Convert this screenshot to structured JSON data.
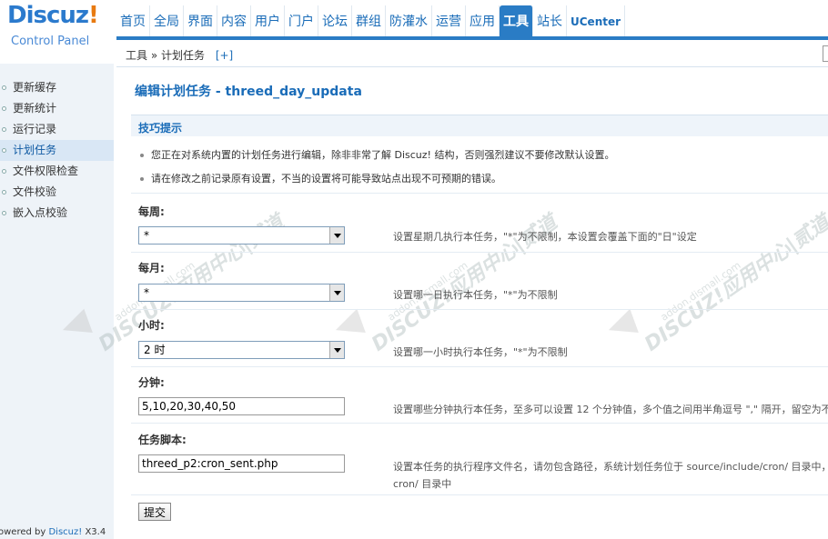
{
  "logo": {
    "brand": "Discuz",
    "exclaim": "!",
    "subtitle": "Control Panel"
  },
  "nav": {
    "tabs": [
      "首页",
      "全局",
      "界面",
      "内容",
      "用户",
      "门户",
      "论坛",
      "群组",
      "防灌水",
      "运营",
      "应用",
      "工具",
      "站长",
      "UCenter"
    ],
    "active": "工具"
  },
  "breadcrumb": {
    "path": "工具 » 计划任务",
    "plus": "[+]"
  },
  "sidebar": {
    "items": [
      "更新缓存",
      "更新统计",
      "运行记录",
      "计划任务",
      "文件权限检查",
      "文件校验",
      "嵌入点校验"
    ],
    "active": "计划任务",
    "powered_prefix": "owered by ",
    "powered_link": "Discuz!",
    "powered_version": " X3.4"
  },
  "main": {
    "title": "编辑计划任务 - threed_day_updata",
    "tips_title": "技巧提示",
    "tips": [
      "您正在对系统内置的计划任务进行编辑，除非非常了解 Discuz! 结构，否则强烈建议不要修改默认设置。",
      "请在修改之前记录原有设置，不当的设置将可能导致站点出现不可预期的错误。"
    ],
    "fields": {
      "week": {
        "label": "每周:",
        "value": "*",
        "desc": "设置星期几执行本任务，\"*\"为不限制，本设置会覆盖下面的\"日\"设定"
      },
      "month": {
        "label": "每月:",
        "value": "*",
        "desc": "设置哪一日执行本任务，\"*\"为不限制"
      },
      "hour": {
        "label": "小时:",
        "value": "2 时",
        "desc": "设置哪一小时执行本任务，\"*\"为不限制"
      },
      "minute": {
        "label": "分钟:",
        "value": "5,10,20,30,40,50",
        "desc": "设置哪些分钟执行本任务，至多可以设置 12 个分钟值，多个值之间用半角逗号 \",\" 隔开，留空为不限"
      },
      "script": {
        "label": "任务脚本:",
        "value": "threed_p2:cron_sent.php",
        "desc_line1": "设置本任务的执行程序文件名，请勿包含路径，系统计划任务位于 source/include/cron/ 目录中，插",
        "desc_line2": "cron/ 目录中"
      }
    },
    "submit_label": "提交"
  },
  "watermark": {
    "text": "DISCUZ!应用中心|贰道",
    "url": "addon.dismall.com"
  },
  "colors": {
    "accent": "#2a7cc5",
    "link": "#1a6cb8",
    "sidebar_bg": "#eef3f8"
  }
}
